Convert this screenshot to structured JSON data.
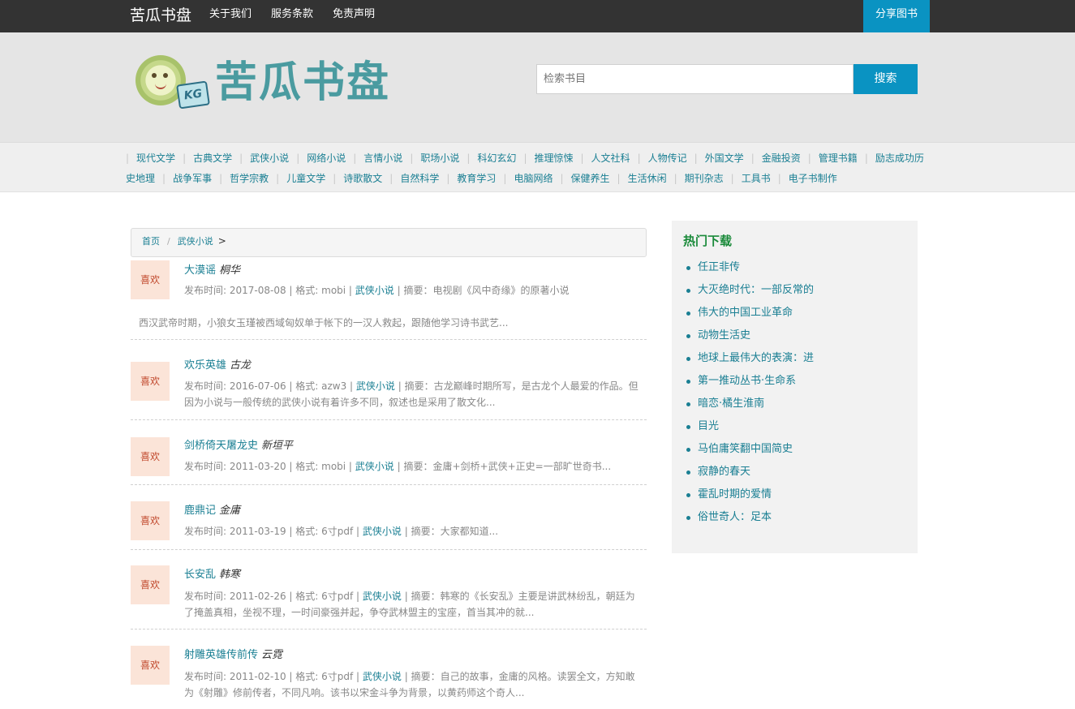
{
  "topbar": {
    "brand": "苦瓜书盘",
    "nav": [
      "关于我们",
      "服务条款",
      "免责声明"
    ],
    "share": "分享图书"
  },
  "header": {
    "logo_text": "苦瓜书盘",
    "logo_badge": "KG",
    "search_placeholder": "检索书目",
    "search_button": "搜索"
  },
  "categories": [
    "现代文学",
    "古典文学",
    "武侠小说",
    "网络小说",
    "言情小说",
    "职场小说",
    "科幻玄幻",
    "推理惊悚",
    "人文社科",
    "人物传记",
    "外国文学",
    "金融投资",
    "管理书籍",
    "励志成功",
    "历史地理",
    "战争军事",
    "哲学宗教",
    "儿童文学",
    "诗歌散文",
    "自然科学",
    "教育学习",
    "电脑网络",
    "保健养生",
    "生活休闲",
    "期刊杂志",
    "工具书",
    "电子书制作"
  ],
  "breadcrumb": {
    "home": "首页",
    "current": "武侠小说",
    "gt": ">"
  },
  "books": [
    {
      "like": "喜欢",
      "title": "大漠谣",
      "author": "桐华",
      "meta_pre": "发布时间: 2017-08-08 | 格式: mobi | ",
      "category": "武侠小说",
      "meta_post": " | 摘要：电视剧《风中奇缘》的原著小说",
      "extra": "西汉武帝时期，小狼女玉瑾被西域匈奴单于帐下的一汉人救起，跟随他学习诗书武艺..."
    },
    {
      "like": "喜欢",
      "title": "欢乐英雄",
      "author": "古龙",
      "meta_pre": "发布时间: 2016-07-06 | 格式: azw3 | ",
      "category": "武侠小说",
      "meta_post": " | 摘要：古龙巅峰时期所写，是古龙个人最爱的作品。但因为小说与一般传统的武侠小说有着许多不同，叙述也是采用了散文化..."
    },
    {
      "like": "喜欢",
      "title": "剑桥倚天屠龙史",
      "author": "新垣平",
      "meta_pre": "发布时间: 2011-03-20 | 格式: mobi | ",
      "category": "武侠小说",
      "meta_post": " | 摘要：金庸+剑桥+武侠+正史=一部旷世奇书..."
    },
    {
      "like": "喜欢",
      "title": "鹿鼎记",
      "author": "金庸",
      "meta_pre": "发布时间: 2011-03-19 | 格式: 6寸pdf | ",
      "category": "武侠小说",
      "meta_post": " | 摘要：大家都知道..."
    },
    {
      "like": "喜欢",
      "title": "长安乱",
      "author": "韩寒",
      "meta_pre": "发布时间: 2011-02-26 | 格式: 6寸pdf | ",
      "category": "武侠小说",
      "meta_post": " | 摘要：韩寒的《长安乱》主要是讲武林纷乱，朝廷为了掩盖真相，坐视不理，一时间豪强并起，争夺武林盟主的宝座，首当其冲的就..."
    },
    {
      "like": "喜欢",
      "title": "射雕英雄传前传",
      "author": "云霓",
      "meta_pre": "发布时间: 2011-02-10 | 格式: 6寸pdf | ",
      "category": "武侠小说",
      "meta_post": " | 摘要：自己的故事，金庸的风格。读罢全文，方知敢为《射雕》修前传者，不同凡响。该书以宋金斗争为背景，以黄药师这个奇人..."
    }
  ],
  "sidebar": {
    "title": "热门下载",
    "items": [
      "任正非传",
      "大灭绝时代：一部反常的",
      "伟大的中国工业革命",
      "动物生活史",
      "地球上最伟大的表演：进",
      "第一推动丛书·生命系",
      "暗恋·橘生淮南",
      "目光",
      "马伯庸笑翻中国简史",
      "寂静的春天",
      "霍乱时期的爱情",
      "俗世奇人：足本"
    ]
  }
}
